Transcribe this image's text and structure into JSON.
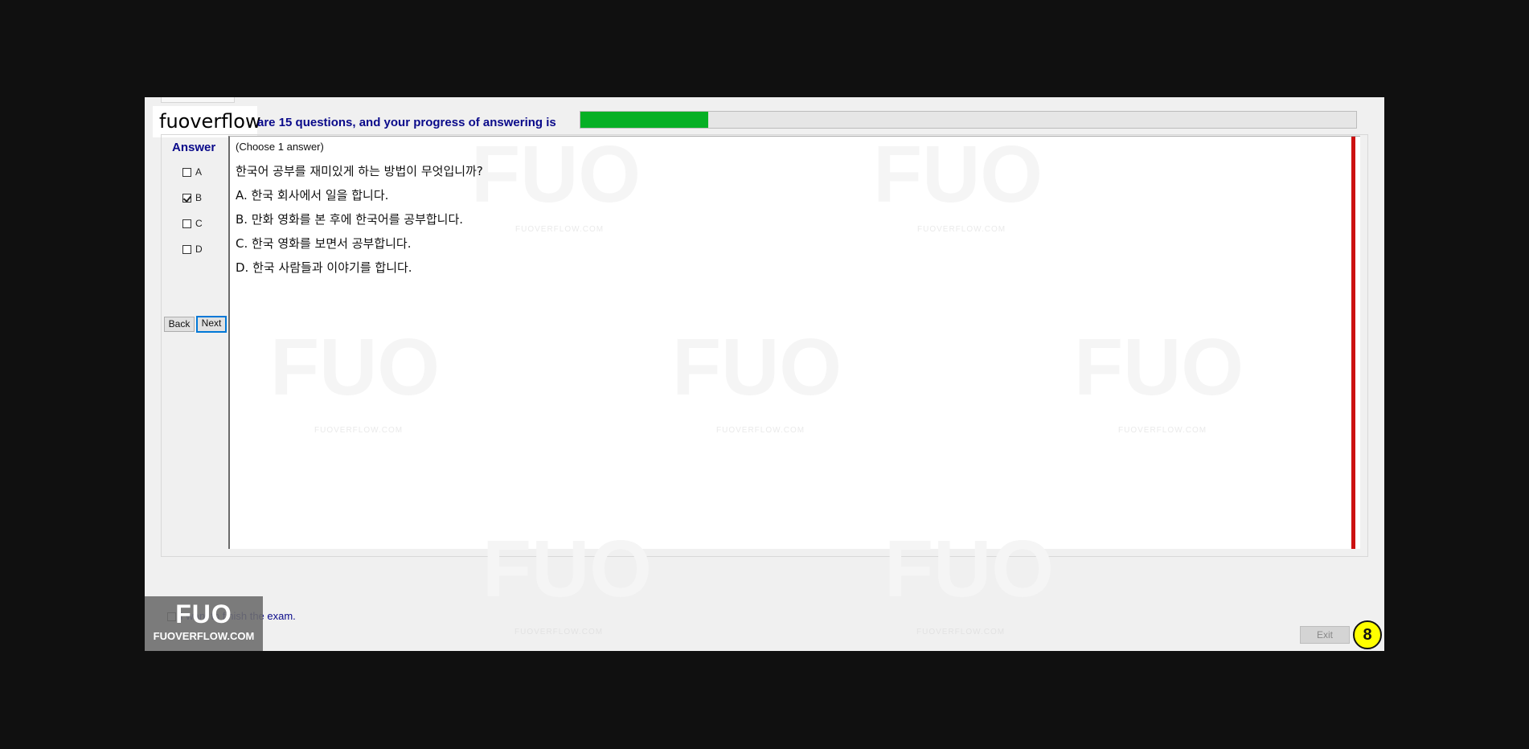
{
  "brand": "fuoverflow",
  "progress": {
    "text": "are 15 questions, and your progress of answering is",
    "value_percent": 16.5,
    "fill_color": "#06b025"
  },
  "answer_panel": {
    "heading": "Answer",
    "options": [
      {
        "label": "A",
        "checked": false
      },
      {
        "label": "B",
        "checked": true
      },
      {
        "label": "C",
        "checked": false
      },
      {
        "label": "D",
        "checked": false
      }
    ],
    "back_label": "Back",
    "next_label": "Next"
  },
  "question": {
    "instruction": "(Choose 1 answer)",
    "stem": "한국어 공부를 재미있게 하는 방법이 무엇입니까?",
    "choices": [
      "A.  한국 회사에서 일을 합니다.",
      "B.  만화 영화를 본 후에 한국어를 공부합니다.",
      "C.  한국 영화를 보면서 공부합니다.",
      "D.  한국 사람들과 이야기를 합니다."
    ]
  },
  "watermark": {
    "logo": "FUO",
    "site": "FUOVERFLOW.COM"
  },
  "finish": {
    "label": "I want to finish the exam."
  },
  "exit_label": "Exit",
  "badge_number": "8",
  "logo": {
    "big": "FUO",
    "small": "FUOVERFLOW.COM"
  }
}
